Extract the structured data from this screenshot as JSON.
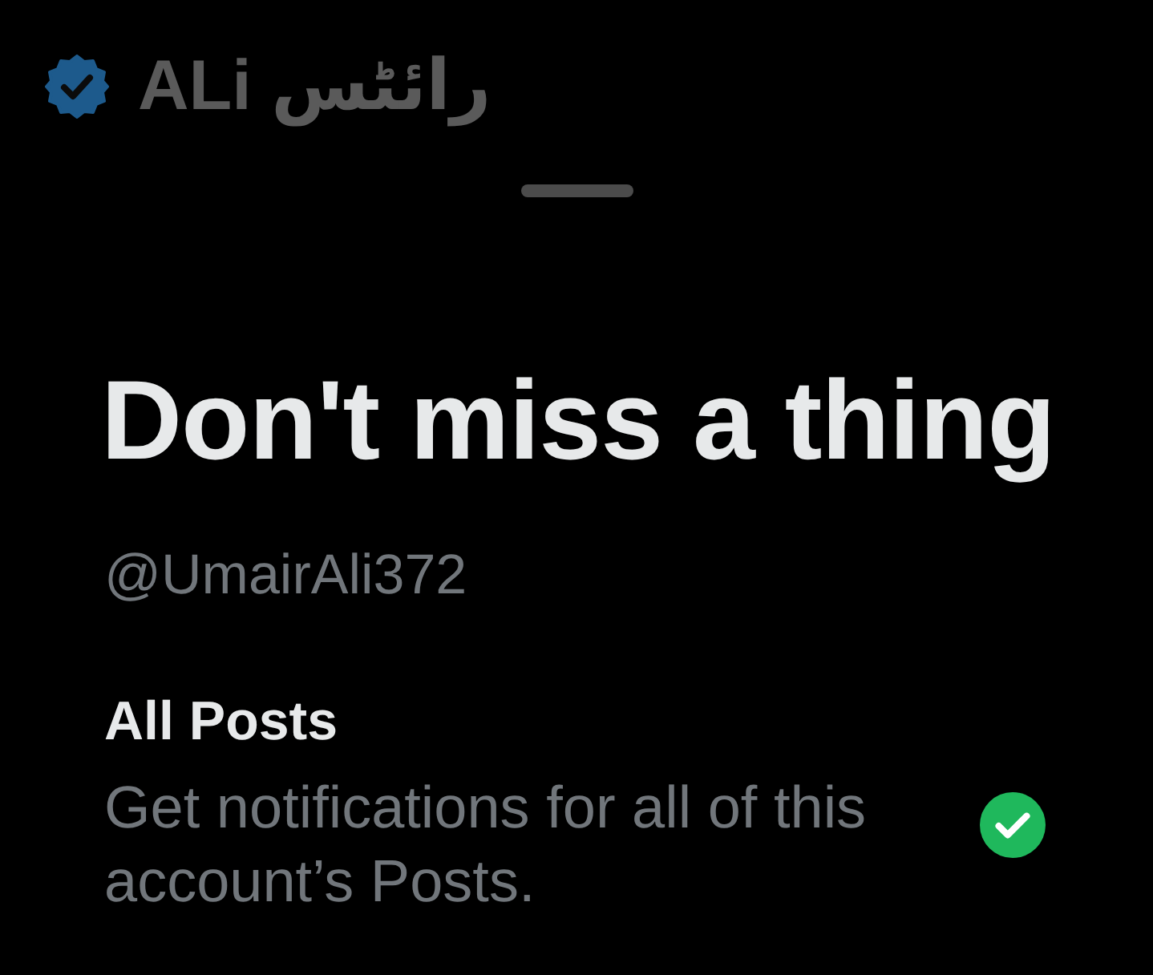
{
  "profile": {
    "verified": true,
    "name": "ALi رائٹس"
  },
  "sheet": {
    "title": "Don't miss a thing",
    "handle": "@UmairAli372",
    "options": [
      {
        "label": "All Posts",
        "description": "Get notifications for all of this account’s Posts.",
        "selected": true
      }
    ]
  }
}
